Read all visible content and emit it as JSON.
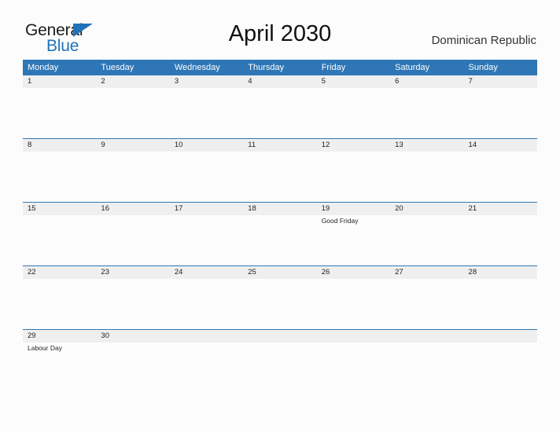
{
  "brand": {
    "line1": "General",
    "line2": "Blue",
    "triangle_color": "#2072b8"
  },
  "header": {
    "title": "April 2030",
    "country": "Dominican Republic"
  },
  "calendar": {
    "header_color": "#2f76b6",
    "date_band_color": "#efefef",
    "weekdays": [
      "Monday",
      "Tuesday",
      "Wednesday",
      "Thursday",
      "Friday",
      "Saturday",
      "Sunday"
    ],
    "weeks": [
      {
        "days": [
          {
            "date": "1",
            "event": ""
          },
          {
            "date": "2",
            "event": ""
          },
          {
            "date": "3",
            "event": ""
          },
          {
            "date": "4",
            "event": ""
          },
          {
            "date": "5",
            "event": ""
          },
          {
            "date": "6",
            "event": ""
          },
          {
            "date": "7",
            "event": ""
          }
        ]
      },
      {
        "days": [
          {
            "date": "8",
            "event": ""
          },
          {
            "date": "9",
            "event": ""
          },
          {
            "date": "10",
            "event": ""
          },
          {
            "date": "11",
            "event": ""
          },
          {
            "date": "12",
            "event": ""
          },
          {
            "date": "13",
            "event": ""
          },
          {
            "date": "14",
            "event": ""
          }
        ]
      },
      {
        "days": [
          {
            "date": "15",
            "event": ""
          },
          {
            "date": "16",
            "event": ""
          },
          {
            "date": "17",
            "event": ""
          },
          {
            "date": "18",
            "event": ""
          },
          {
            "date": "19",
            "event": "Good Friday"
          },
          {
            "date": "20",
            "event": ""
          },
          {
            "date": "21",
            "event": ""
          }
        ]
      },
      {
        "days": [
          {
            "date": "22",
            "event": ""
          },
          {
            "date": "23",
            "event": ""
          },
          {
            "date": "24",
            "event": ""
          },
          {
            "date": "25",
            "event": ""
          },
          {
            "date": "26",
            "event": ""
          },
          {
            "date": "27",
            "event": ""
          },
          {
            "date": "28",
            "event": ""
          }
        ]
      },
      {
        "days": [
          {
            "date": "29",
            "event": "Labour Day"
          },
          {
            "date": "30",
            "event": ""
          },
          {
            "date": "",
            "event": ""
          },
          {
            "date": "",
            "event": ""
          },
          {
            "date": "",
            "event": ""
          },
          {
            "date": "",
            "event": ""
          },
          {
            "date": "",
            "event": ""
          }
        ]
      }
    ]
  }
}
